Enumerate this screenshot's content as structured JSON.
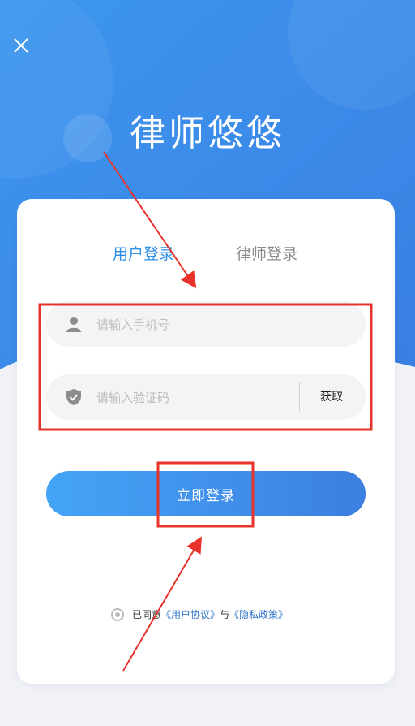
{
  "app": {
    "title": "律师悠悠"
  },
  "tabs": [
    {
      "label": "用户登录",
      "active": true
    },
    {
      "label": "律师登录",
      "active": false
    }
  ],
  "form": {
    "phone": {
      "placeholder": "请输入手机号",
      "value": "",
      "icon": "user-icon"
    },
    "code": {
      "placeholder": "请输入验证码",
      "value": "",
      "icon": "shield-check-icon",
      "action_label": "获取"
    }
  },
  "login_button": {
    "label": "立即登录"
  },
  "agreement": {
    "prefix": "已同意",
    "user_agreement": "《用户协议》",
    "conjunction": "与",
    "privacy_policy": "《隐私政策》"
  },
  "colors": {
    "brand_blue": "#3c8ef0",
    "tab_active": "#2f8fe8",
    "annotation_red": "#e8322b"
  }
}
